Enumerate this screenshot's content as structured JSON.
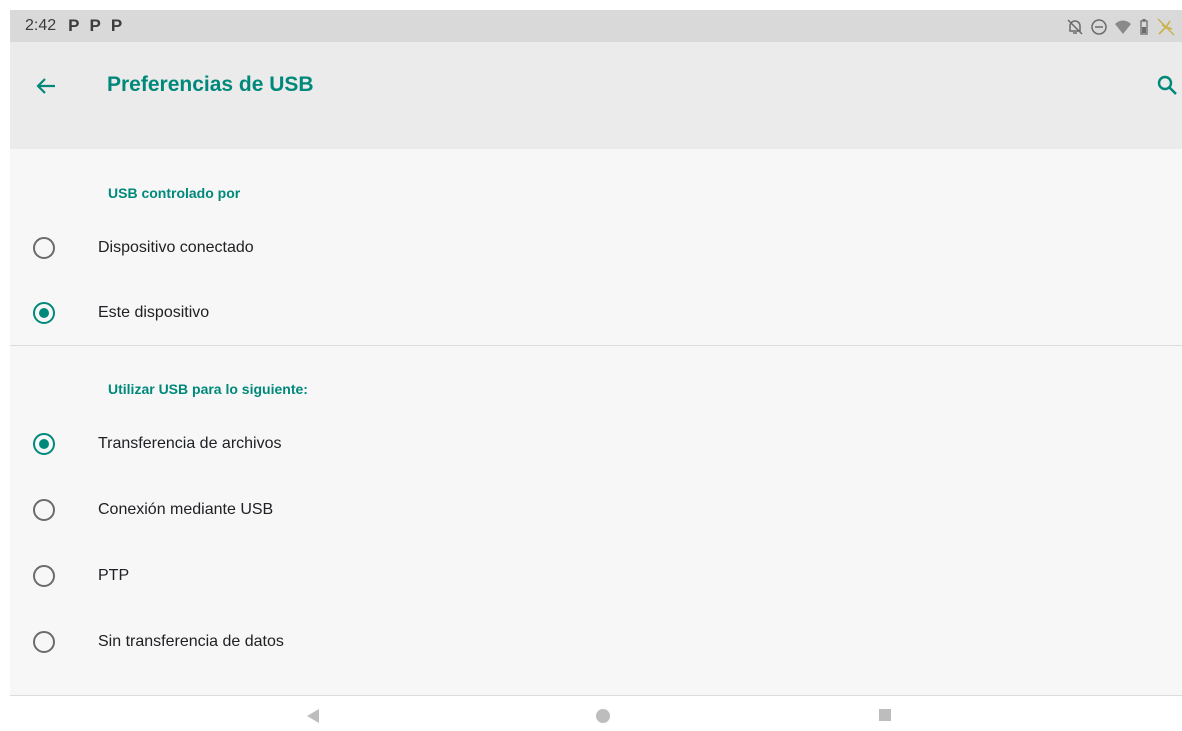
{
  "status_bar": {
    "time": "2:42",
    "notifications": [
      "P",
      "P",
      "P"
    ],
    "icons": [
      "alarm-off-icon",
      "dnd-icon",
      "wifi-icon",
      "battery-icon",
      "usb-debug-icon"
    ]
  },
  "app_bar": {
    "title": "Preferencias de USB",
    "back_icon": "arrow-back-icon",
    "search_icon": "search-icon"
  },
  "sections": [
    {
      "header": "USB controlado por",
      "options": [
        {
          "label": "Dispositivo conectado",
          "checked": false
        },
        {
          "label": "Este dispositivo",
          "checked": true
        }
      ]
    },
    {
      "header": "Utilizar USB para lo siguiente:",
      "options": [
        {
          "label": "Transferencia de archivos",
          "checked": true
        },
        {
          "label": "Conexión mediante USB",
          "checked": false
        },
        {
          "label": "PTP",
          "checked": false
        },
        {
          "label": "Sin transferencia de datos",
          "checked": false
        }
      ]
    }
  ],
  "nav_bar": {
    "buttons": [
      "back-triangle-icon",
      "home-circle-icon",
      "recents-square-icon"
    ]
  },
  "colors": {
    "accent": "#00897b",
    "background": "#f7f7f7",
    "app_bar": "#ebebeb",
    "status_bar": "#d9d9d9"
  }
}
